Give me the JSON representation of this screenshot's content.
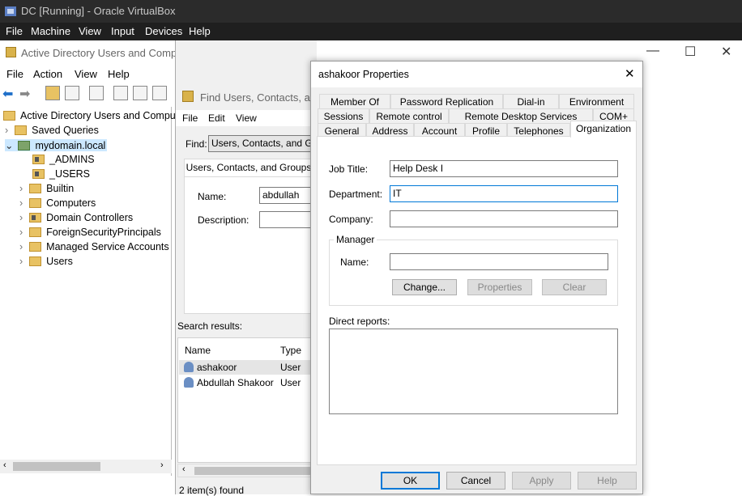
{
  "vbox": {
    "title": "DC [Running] - Oracle VirtualBox",
    "menu": [
      "File",
      "Machine",
      "View",
      "Input",
      "Devices",
      "Help"
    ]
  },
  "aduc": {
    "title": "Active Directory Users and Computers",
    "menu": [
      "File",
      "Action",
      "View",
      "Help"
    ],
    "tree": {
      "root": "Active Directory Users and Comput",
      "items": [
        "Saved Queries",
        "mydomain.local",
        "_ADMINS",
        "_USERS",
        "Builtin",
        "Computers",
        "Domain Controllers",
        "ForeignSecurityPrincipals",
        "Managed Service Accounts",
        "Users"
      ]
    }
  },
  "find": {
    "title": "Find Users, Contacts, and",
    "menu": [
      "File",
      "Edit",
      "View"
    ],
    "find_label": "Find:",
    "find_value": "Users, Contacts, and Grou",
    "tab": "Users, Contacts, and Groups",
    "name_label": "Name:",
    "name_value": "abdullah",
    "desc_label": "Description:",
    "results_label": "Search results:",
    "col_name": "Name",
    "col_type": "Type",
    "rows": [
      {
        "name": "ashakoor",
        "type": "User"
      },
      {
        "name": "Abdullah Shakoor",
        "type": "User"
      }
    ],
    "status": "2 item(s) found"
  },
  "props": {
    "title": "ashakoor Properties",
    "close": "✕",
    "tabs_row1": [
      "Member Of",
      "Password Replication",
      "Dial-in",
      "Environment"
    ],
    "tabs_row2": [
      "Sessions",
      "Remote control",
      "Remote Desktop Services Profile",
      "COM+"
    ],
    "tabs_row3": [
      "General",
      "Address",
      "Account",
      "Profile",
      "Telephones",
      "Organization"
    ],
    "job_title_label": "Job Title:",
    "job_title": "Help Desk I",
    "department_label": "Department:",
    "department": "IT",
    "company_label": "Company:",
    "company": "",
    "manager_group": "Manager",
    "manager_name_label": "Name:",
    "manager_name": "",
    "change_btn": "Change...",
    "properties_btn": "Properties",
    "clear_btn": "Clear",
    "direct_reports_label": "Direct reports:",
    "ok": "OK",
    "cancel": "Cancel",
    "apply": "Apply",
    "help": "Help"
  }
}
